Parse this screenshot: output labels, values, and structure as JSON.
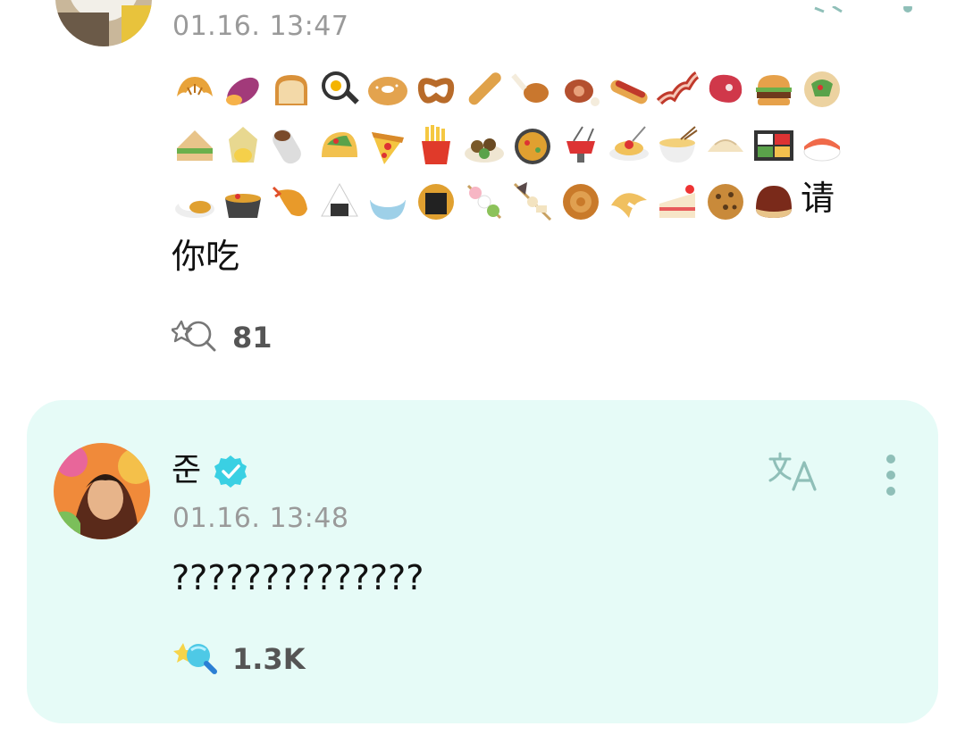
{
  "post1": {
    "timestamp": "01.16. 13:47",
    "body_suffix_line1": "请",
    "body_line2": "你吃",
    "reaction_count": "81"
  },
  "post2": {
    "author": "준",
    "timestamp": "01.16. 13:48",
    "body": "??????????????",
    "reaction_count": "1.3K",
    "translate_label": "文A"
  },
  "emoji_rows": [
    [
      "croissant",
      "sweet-potato",
      "bread",
      "fried-egg",
      "bagel",
      "pretzel",
      "baguette",
      "poultry-leg",
      "meat-on-bone",
      "hot-dog",
      "bacon",
      "cut-of-meat",
      "hamburger",
      "stuffed-flatbread"
    ],
    [
      "sandwich",
      "tamale",
      "burrito",
      "taco",
      "pizza",
      "fries",
      "falafel",
      "paella",
      "fondue",
      "spaghetti",
      "ramen",
      "dumpling",
      "bento",
      "sushi"
    ],
    [
      "curry-rice",
      "stew",
      "fried-shrimp",
      "rice-ball",
      "cooked-rice",
      "rice-cracker",
      "dango",
      "oden",
      "moon-cake",
      "fortune-cookie",
      "shortcake",
      "cookie",
      "chestnut"
    ]
  ],
  "colors": {
    "card_bg": "#e6fbf7",
    "verified": "#3ad0e3",
    "icon_teal": "#8fbfb8",
    "timestamp": "#9a9a9a"
  }
}
